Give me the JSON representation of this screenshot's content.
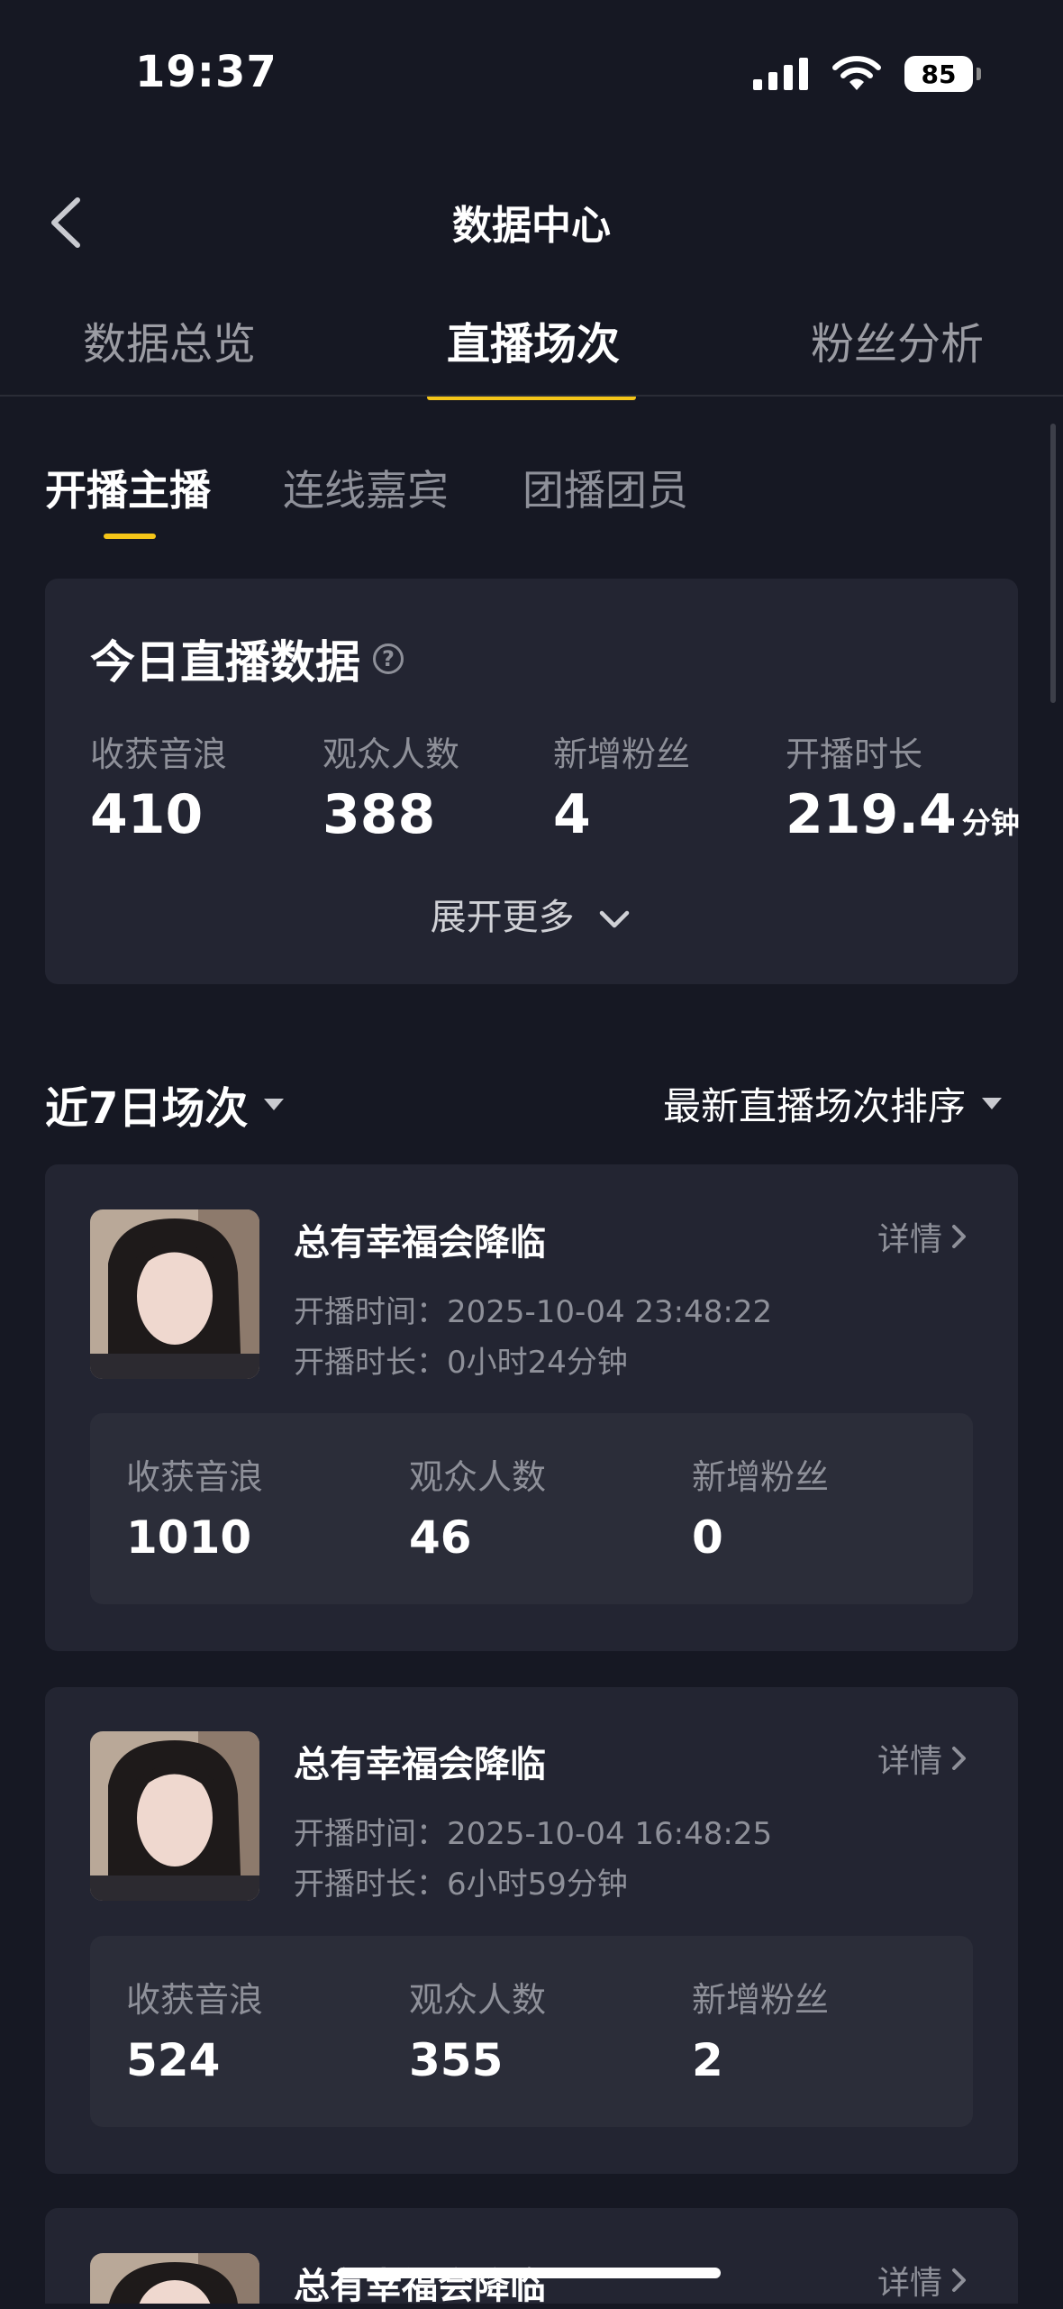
{
  "status_bar": {
    "time": "19:37",
    "battery": "85"
  },
  "header": {
    "title": "数据中心"
  },
  "tabs": [
    "数据总览",
    "直播场次",
    "粉丝分析"
  ],
  "sub_tabs": [
    "开播主播",
    "连线嘉宾",
    "团播团员"
  ],
  "today": {
    "title": "今日直播数据",
    "stats": [
      {
        "label": "收获音浪",
        "value": "410"
      },
      {
        "label": "观众人数",
        "value": "388"
      },
      {
        "label": "新增粉丝",
        "value": "4"
      },
      {
        "label": "开播时长",
        "value": "219.4",
        "unit": "分钟"
      }
    ],
    "expand_label": "展开更多"
  },
  "section": {
    "title": "近7日场次",
    "sort_label": "最新直播场次排序"
  },
  "sessions": [
    {
      "name": "总有幸福会降临",
      "detail_label": "详情",
      "start_time": "开播时间：2025-10-04 23:48:22",
      "duration": "开播时长：0小时24分钟",
      "stats": [
        {
          "label": "收获音浪",
          "value": "1010"
        },
        {
          "label": "观众人数",
          "value": "46"
        },
        {
          "label": "新增粉丝",
          "value": "0"
        }
      ]
    },
    {
      "name": "总有幸福会降临",
      "detail_label": "详情",
      "start_time": "开播时间：2025-10-04 16:48:25",
      "duration": "开播时长：6小时59分钟",
      "stats": [
        {
          "label": "收获音浪",
          "value": "524"
        },
        {
          "label": "观众人数",
          "value": "355"
        },
        {
          "label": "新增粉丝",
          "value": "2"
        }
      ]
    },
    {
      "name": "总有幸福会降临",
      "detail_label": "详情"
    }
  ],
  "colors": {
    "background": "#161823",
    "card": "#232532",
    "accent": "#f5c518",
    "muted": "#8e9099"
  }
}
